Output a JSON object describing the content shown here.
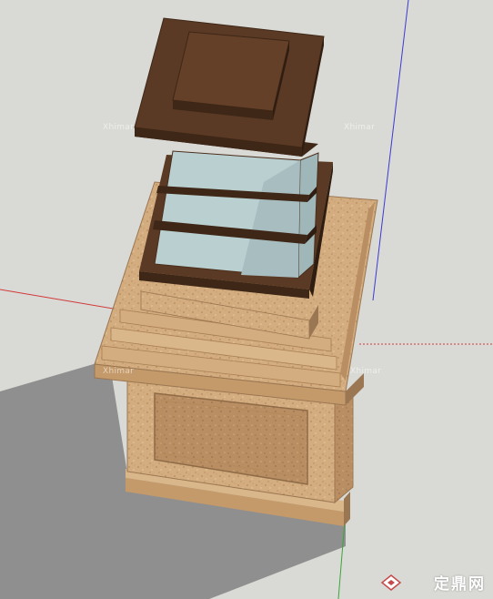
{
  "viewport": {
    "background": "#d9d9d5",
    "axes": {
      "red_axis": "#d13a3a",
      "green_axis": "#3aa63a",
      "blue_axis": "#3a3ad1"
    }
  },
  "model": {
    "name": "square lantern pillar",
    "parts": [
      "base plinth",
      "pedestal body with recessed panel",
      "top slab",
      "lantern glass body",
      "lantern cap"
    ],
    "colors": {
      "stone_light": "#d9b78a",
      "stone_mid": "#c59a6a",
      "stone_dark": "#9a7652",
      "wood_dark": "#4a2e1c",
      "wood_top": "#5a3a24",
      "glass": "#b9cfd0",
      "shadow": "#8f8f8f"
    }
  },
  "watermarks": {
    "wm1": "Xhimar",
    "wm2": "Xhimar",
    "wm3": "Xhimar",
    "wm4": "Xhimar"
  },
  "brand": {
    "logo_icon": "diamond-logo-icon",
    "text": "定鼎网"
  }
}
